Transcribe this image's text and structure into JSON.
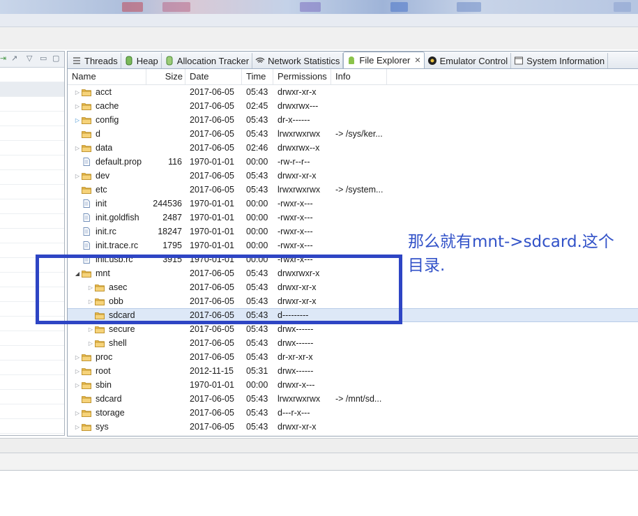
{
  "tabs": [
    {
      "label": "Threads",
      "icon": "threads-icon",
      "active": false
    },
    {
      "label": "Heap",
      "icon": "heap-icon",
      "active": false
    },
    {
      "label": "Allocation Tracker",
      "icon": "allocation-icon",
      "active": false
    },
    {
      "label": "Network Statistics",
      "icon": "network-icon",
      "active": false
    },
    {
      "label": "File Explorer",
      "icon": "android-icon",
      "active": true
    },
    {
      "label": "Emulator Control",
      "icon": "emulator-icon",
      "active": false
    },
    {
      "label": "System Information",
      "icon": "system-info-icon",
      "active": false
    }
  ],
  "columns": {
    "name": "Name",
    "size": "Size",
    "date": "Date",
    "time": "Time",
    "permissions": "Permissions",
    "info": "Info"
  },
  "files": [
    {
      "name": "acct",
      "size": "",
      "date": "2017-06-05",
      "time": "05:43",
      "perm": "drwxr-xr-x",
      "info": "",
      "type": "folder",
      "level": 0,
      "arrow": "right"
    },
    {
      "name": "cache",
      "size": "",
      "date": "2017-06-05",
      "time": "02:45",
      "perm": "drwxrwx---",
      "info": "",
      "type": "folder",
      "level": 0,
      "arrow": "right"
    },
    {
      "name": "config",
      "size": "",
      "date": "2017-06-05",
      "time": "05:43",
      "perm": "dr-x------",
      "info": "",
      "type": "folder",
      "level": 0,
      "arrow": "right-blue"
    },
    {
      "name": "d",
      "size": "",
      "date": "2017-06-05",
      "time": "05:43",
      "perm": "lrwxrwxrwx",
      "info": "-> /sys/ker...",
      "type": "folder",
      "level": 0,
      "arrow": ""
    },
    {
      "name": "data",
      "size": "",
      "date": "2017-06-05",
      "time": "02:46",
      "perm": "drwxrwx--x",
      "info": "",
      "type": "folder",
      "level": 0,
      "arrow": "right"
    },
    {
      "name": "default.prop",
      "size": "116",
      "date": "1970-01-01",
      "time": "00:00",
      "perm": "-rw-r--r--",
      "info": "",
      "type": "file",
      "level": 0,
      "arrow": ""
    },
    {
      "name": "dev",
      "size": "",
      "date": "2017-06-05",
      "time": "05:43",
      "perm": "drwxr-xr-x",
      "info": "",
      "type": "folder",
      "level": 0,
      "arrow": "right"
    },
    {
      "name": "etc",
      "size": "",
      "date": "2017-06-05",
      "time": "05:43",
      "perm": "lrwxrwxrwx",
      "info": "-> /system...",
      "type": "folder",
      "level": 0,
      "arrow": ""
    },
    {
      "name": "init",
      "size": "244536",
      "date": "1970-01-01",
      "time": "00:00",
      "perm": "-rwxr-x---",
      "info": "",
      "type": "file",
      "level": 0,
      "arrow": ""
    },
    {
      "name": "init.goldfish",
      "size": "2487",
      "date": "1970-01-01",
      "time": "00:00",
      "perm": "-rwxr-x---",
      "info": "",
      "type": "file",
      "level": 0,
      "arrow": ""
    },
    {
      "name": "init.rc",
      "size": "18247",
      "date": "1970-01-01",
      "time": "00:00",
      "perm": "-rwxr-x---",
      "info": "",
      "type": "file",
      "level": 0,
      "arrow": ""
    },
    {
      "name": "init.trace.rc",
      "size": "1795",
      "date": "1970-01-01",
      "time": "00:00",
      "perm": "-rwxr-x---",
      "info": "",
      "type": "file",
      "level": 0,
      "arrow": ""
    },
    {
      "name": "init.usb.rc",
      "size": "3915",
      "date": "1970-01-01",
      "time": "00:00",
      "perm": "-rwxr-x---",
      "info": "",
      "type": "file",
      "level": 0,
      "arrow": ""
    },
    {
      "name": "mnt",
      "size": "",
      "date": "2017-06-05",
      "time": "05:43",
      "perm": "drwxrwxr-x",
      "info": "",
      "type": "folder",
      "level": 0,
      "arrow": "down"
    },
    {
      "name": "asec",
      "size": "",
      "date": "2017-06-05",
      "time": "05:43",
      "perm": "drwxr-xr-x",
      "info": "",
      "type": "folder",
      "level": 1,
      "arrow": "right"
    },
    {
      "name": "obb",
      "size": "",
      "date": "2017-06-05",
      "time": "05:43",
      "perm": "drwxr-xr-x",
      "info": "",
      "type": "folder",
      "level": 1,
      "arrow": "right"
    },
    {
      "name": "sdcard",
      "size": "",
      "date": "2017-06-05",
      "time": "05:43",
      "perm": "d---------",
      "info": "",
      "type": "folder",
      "level": 1,
      "arrow": "",
      "selected": true
    },
    {
      "name": "secure",
      "size": "",
      "date": "2017-06-05",
      "time": "05:43",
      "perm": "drwx------",
      "info": "",
      "type": "folder",
      "level": 1,
      "arrow": "right"
    },
    {
      "name": "shell",
      "size": "",
      "date": "2017-06-05",
      "time": "05:43",
      "perm": "drwx------",
      "info": "",
      "type": "folder",
      "level": 1,
      "arrow": "right"
    },
    {
      "name": "proc",
      "size": "",
      "date": "2017-06-05",
      "time": "05:43",
      "perm": "dr-xr-xr-x",
      "info": "",
      "type": "folder",
      "level": 0,
      "arrow": "right"
    },
    {
      "name": "root",
      "size": "",
      "date": "2012-11-15",
      "time": "05:31",
      "perm": "drwx------",
      "info": "",
      "type": "folder",
      "level": 0,
      "arrow": "right"
    },
    {
      "name": "sbin",
      "size": "",
      "date": "1970-01-01",
      "time": "00:00",
      "perm": "drwxr-x---",
      "info": "",
      "type": "folder",
      "level": 0,
      "arrow": "right"
    },
    {
      "name": "sdcard",
      "size": "",
      "date": "2017-06-05",
      "time": "05:43",
      "perm": "lrwxrwxrwx",
      "info": "-> /mnt/sd...",
      "type": "folder",
      "level": 0,
      "arrow": ""
    },
    {
      "name": "storage",
      "size": "",
      "date": "2017-06-05",
      "time": "05:43",
      "perm": "d---r-x---",
      "info": "",
      "type": "folder",
      "level": 0,
      "arrow": "right"
    },
    {
      "name": "sys",
      "size": "",
      "date": "2017-06-05",
      "time": "05:43",
      "perm": "drwxr-xr-x",
      "info": "",
      "type": "folder",
      "level": 0,
      "arrow": "right"
    }
  ],
  "annotation": {
    "line1": "那么就有mnt->sdcard.这个",
    "line2": "目录.",
    "color": "#3252c8"
  },
  "colors": {
    "folder": "#e8b84a",
    "selection": "#dde8f7",
    "annotation_box": "#2e45c4"
  }
}
